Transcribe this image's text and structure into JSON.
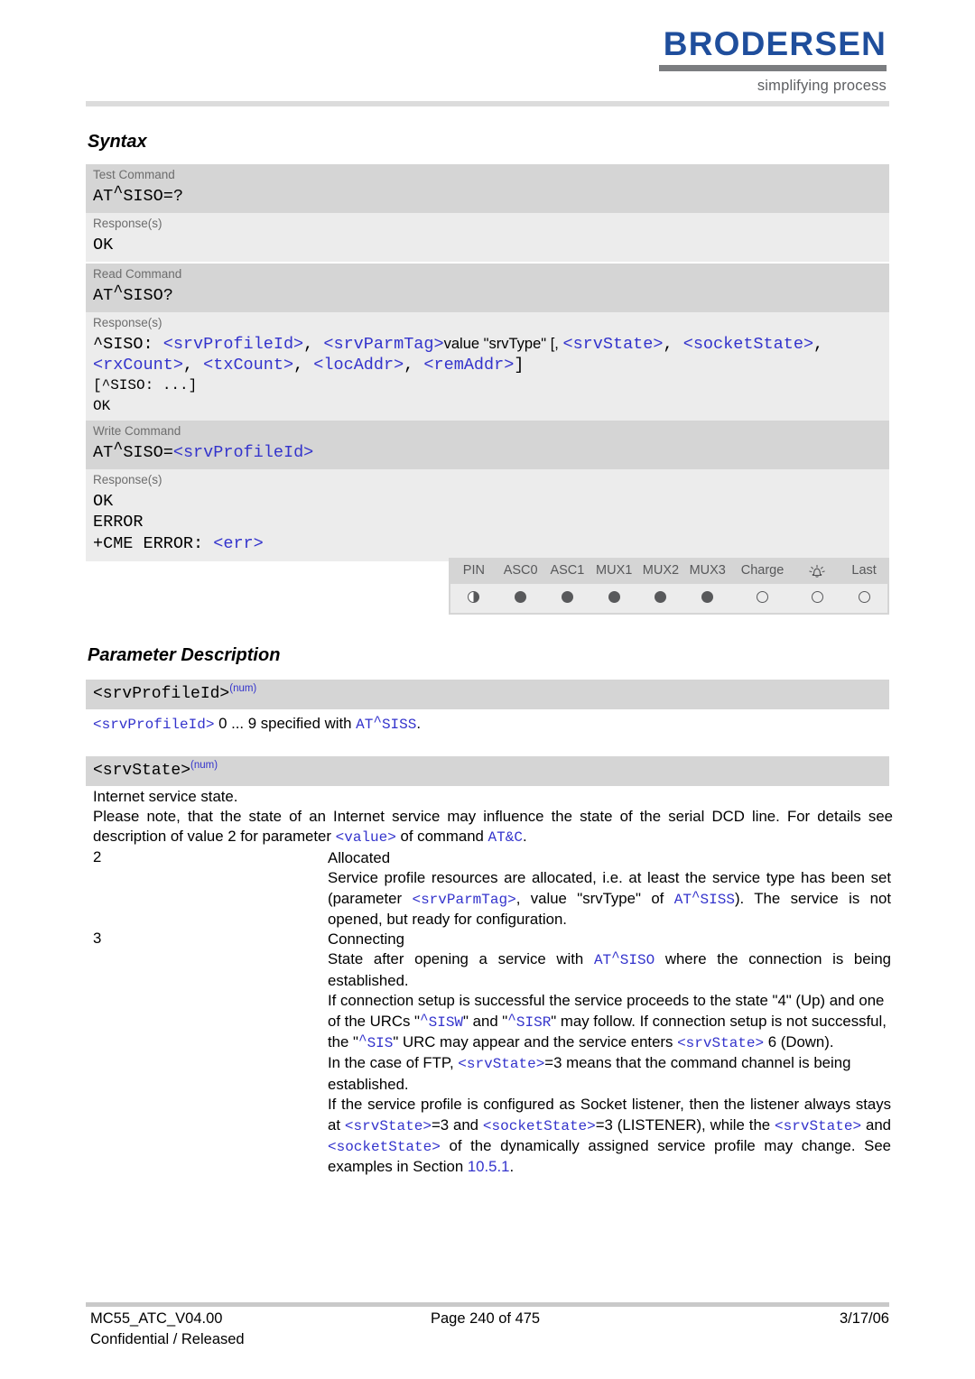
{
  "header": {
    "brand_name": "BRODERSEN",
    "brand_tagline": "simplifying process"
  },
  "sections": {
    "syntax_title": "Syntax",
    "parameter_title": "Parameter Description"
  },
  "syntax": {
    "test_command": {
      "label": "Test Command",
      "command_at": "AT",
      "command_caret": "^",
      "command_rest": "SISO=?",
      "response_label": "Response(s)",
      "response": "OK"
    },
    "read_command": {
      "label": "Read Command",
      "command_at": "AT",
      "command_caret": "^",
      "command_rest": "SISO?",
      "response_label": "Response(s)",
      "resp_line1_prefix": "^SISO: ",
      "resp_p_srvprofileid": "<srvProfileId>",
      "resp_comma1": ", ",
      "resp_p_srvparmtag": "<srvParmTag>",
      "resp_value_text": "value \"srvType\" [, ",
      "resp_p_srvstate": "<srvState>",
      "resp_comma2": ", ",
      "resp_p_socketstate": "<socketState>",
      "resp_comma3": ",",
      "resp_p_rxcount": "<rxCount>",
      "resp_comma4": ", ",
      "resp_p_txcount": "<txCount>",
      "resp_comma5": ", ",
      "resp_p_locaddr": "<locAddr>",
      "resp_comma6": ", ",
      "resp_p_remaddr": "<remAddr>",
      "resp_bracket_close": "]",
      "resp_line3": "[^SISO: ...]",
      "resp_line4": "OK"
    },
    "write_command": {
      "label": "Write Command",
      "command_at": "AT",
      "command_caret": "^",
      "command_rest": "SISO=",
      "command_param": "<srvProfileId>",
      "response_label": "Response(s)",
      "response_ok": "OK",
      "response_error": "ERROR",
      "response_cme_prefix": "+CME ERROR: ",
      "response_cme_param": "<err>"
    }
  },
  "capability_table": {
    "columns": [
      {
        "label": "PIN",
        "state": "half"
      },
      {
        "label": "ASC0",
        "state": "full"
      },
      {
        "label": "ASC1",
        "state": "full"
      },
      {
        "label": "MUX1",
        "state": "full"
      },
      {
        "label": "MUX2",
        "state": "full"
      },
      {
        "label": "MUX3",
        "state": "full"
      },
      {
        "label": "Charge",
        "state": "empty"
      },
      {
        "label": "alarm-bell-icon",
        "state": "empty"
      },
      {
        "label": "Last",
        "state": "empty"
      }
    ]
  },
  "parameters": {
    "srv_profile_id": {
      "name": "<srvProfileId>",
      "type_sup": "(num)",
      "desc_param": "<srvProfileId>",
      "desc_text": " 0 ... 9 specified with ",
      "desc_cmd_at": "AT",
      "desc_cmd_caret": "^",
      "desc_cmd_rest": "SISS",
      "desc_end": "."
    },
    "srv_state": {
      "name": "<srvState>",
      "type_sup": "(num)",
      "intro_line1": "Internet service state.",
      "intro_line2a": "Please note, that the state of an Internet service may influence the state of the serial DCD line. For details see description of value 2 for parameter ",
      "intro_param_value": "<value>",
      "intro_line2b": " of command ",
      "intro_cmd_atc": "AT&C",
      "intro_line2c": ".",
      "values": [
        {
          "number": "2",
          "title": "Allocated",
          "body_a": "Service profile resources are allocated, i.e. at least the service type has been set (parameter ",
          "param_1": "<srvParmTag>",
          "body_b": ", value \"srvType\" of ",
          "cmd_at": "AT",
          "cmd_caret": "^",
          "cmd_rest": "SISS",
          "body_c": "). The service is not opened, but ready for configuration."
        },
        {
          "number": "3",
          "title": "Connecting",
          "p1_a": "State after opening a service with ",
          "p1_cmd_at": "AT",
          "p1_cmd_caret": "^",
          "p1_cmd_rest": "SISO",
          "p1_b": " where the connection is being established.",
          "p2_a": "If connection setup is successful the service proceeds to the state \"4\" (Up) and one of the URCs \"",
          "p2_urc1_caret": "^",
          "p2_urc1_rest": "SISW",
          "p2_b": "\" and \"",
          "p2_urc2_caret": "^",
          "p2_urc2_rest": "SISR",
          "p2_c": "\" may follow. If connection setup is not successful, the \"",
          "p2_urc3_caret": "^",
          "p2_urc3_rest": "SIS",
          "p2_d": "\" URC may appear and the service enters ",
          "p2_param_srvstate": "<srvState>",
          "p2_e": " 6 (Down).",
          "p3_a": "In the case of FTP, ",
          "p3_param": "<srvState>",
          "p3_b": "=3 means that the command channel is being established.",
          "p4_a": "If the service profile is configured as Socket listener, then the listener always stays at ",
          "p4_param1": "<srvState>",
          "p4_b": "=3 and ",
          "p4_param2": "<socketState>",
          "p4_c": "=3 (LISTENER), while the ",
          "p4_param3": "<srvState>",
          "p4_d": " and ",
          "p4_param4": "<socketState>",
          "p4_e": " of the dynamically assigned service profile may change. See examples in Section ",
          "p4_section_ref": "10.5.1",
          "p4_f": "."
        }
      ]
    }
  },
  "footer": {
    "document_id": "MC55_ATC_V04.00",
    "page_info": "Page 240 of 475",
    "date": "3/17/06",
    "classification": "Confidential / Released"
  },
  "colors": {
    "brand_blue": "#1f4e9c",
    "link_blue": "#3333cc",
    "band_command": "#d5d5d5",
    "band_response": "#ececec"
  }
}
